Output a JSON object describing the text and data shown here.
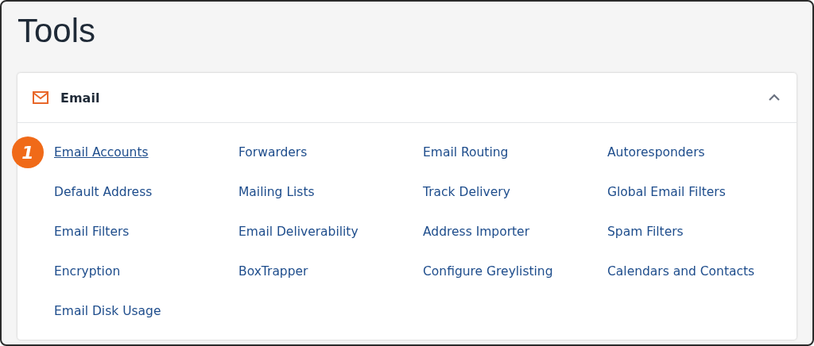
{
  "page": {
    "title": "Tools"
  },
  "section": {
    "title": "Email",
    "expanded": true,
    "items": [
      {
        "label": "Email Accounts",
        "underlined": true,
        "callout": "1"
      },
      {
        "label": "Forwarders",
        "underlined": false
      },
      {
        "label": "Email Routing",
        "underlined": false
      },
      {
        "label": "Autoresponders",
        "underlined": false
      },
      {
        "label": "Default Address",
        "underlined": false
      },
      {
        "label": "Mailing Lists",
        "underlined": false
      },
      {
        "label": "Track Delivery",
        "underlined": false
      },
      {
        "label": "Global Email Filters",
        "underlined": false
      },
      {
        "label": "Email Filters",
        "underlined": false
      },
      {
        "label": "Email Deliverability",
        "underlined": false
      },
      {
        "label": "Address Importer",
        "underlined": false
      },
      {
        "label": "Spam Filters",
        "underlined": false
      },
      {
        "label": "Encryption",
        "underlined": false
      },
      {
        "label": "BoxTrapper",
        "underlined": false
      },
      {
        "label": "Configure Greylisting",
        "underlined": false
      },
      {
        "label": "Calendars and Contacts",
        "underlined": false
      },
      {
        "label": "Email Disk Usage",
        "underlined": false
      }
    ]
  }
}
